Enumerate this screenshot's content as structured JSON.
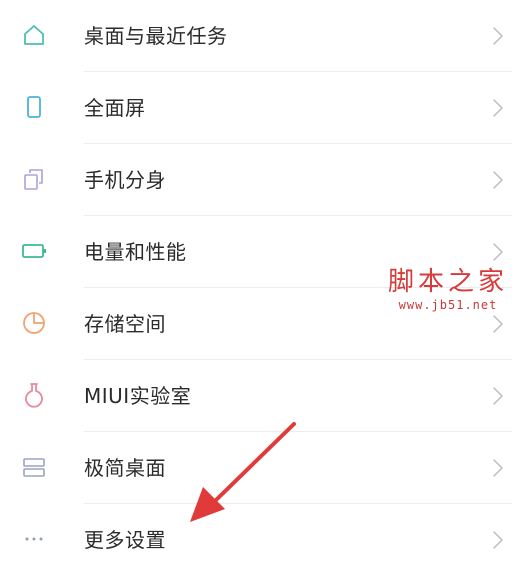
{
  "settings_list": {
    "items": [
      {
        "label": "桌面与最近任务",
        "icon": "home-icon"
      },
      {
        "label": "全面屏",
        "icon": "phone-screen-icon"
      },
      {
        "label": "手机分身",
        "icon": "dual-copy-icon"
      },
      {
        "label": "电量和性能",
        "icon": "battery-icon"
      },
      {
        "label": "存储空间",
        "icon": "pie-chart-icon"
      },
      {
        "label": "MIUI实验室",
        "icon": "flask-icon"
      },
      {
        "label": "极简桌面",
        "icon": "simple-desktop-icon"
      },
      {
        "label": "更多设置",
        "icon": "more-dots-icon"
      }
    ]
  },
  "watermark": {
    "title": "脚本之家",
    "url": "www.jb51.net"
  },
  "annotation": {
    "icon": "red-arrow-pointer",
    "color": "#e03a3a"
  },
  "colors": {
    "icon_teal": "#4dbfb0",
    "icon_blue": "#4ab3d8",
    "icon_purple": "#a8a3d6",
    "icon_green": "#3fb89a",
    "icon_orange": "#f0a373",
    "icon_pink": "#e88aa0",
    "icon_slate": "#9aa3c4",
    "icon_gray": "#8fa0b4"
  }
}
